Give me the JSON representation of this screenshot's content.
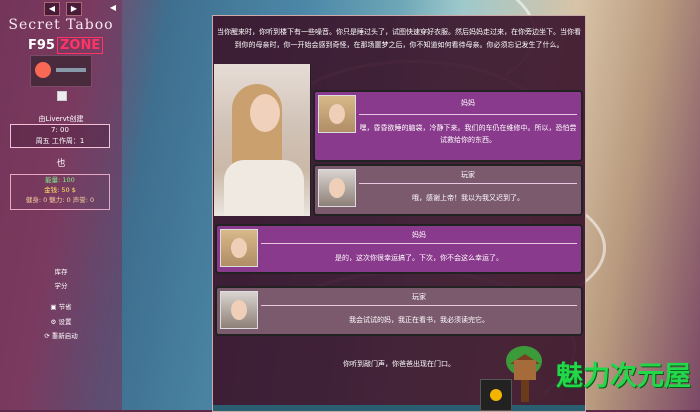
{
  "sidebar": {
    "nav_back": "◀",
    "nav_forward": "▶",
    "collapse": "◀",
    "game_title": "Secret Taboo",
    "f95_prefix": "F95",
    "f95_suffix": "ZONE",
    "creator": "由Livervt创建",
    "time": "7: 00",
    "day": "周五 工作周：1",
    "char_name": "也",
    "energy": "能量: 100",
    "money": "金钱: 50 $",
    "misc": "健身: 0 魅力: 0 声誉: 0",
    "menu": [
      "库存",
      "学分"
    ],
    "options": [
      {
        "icon": "save-icon",
        "label": "节省"
      },
      {
        "icon": "gear-icon",
        "label": "设置"
      },
      {
        "icon": "restart-icon",
        "label": "重新启动"
      }
    ]
  },
  "main": {
    "intro": "当你醒来时，你听到楼下有一些噪音。你只是睡过头了，试图快速穿好衣服。然后妈妈走过来，在你旁边坐下。当你看到你的母亲时，你一开始会感到奇怪，在那场噩梦之后，你不知道如何看待母亲。你必须忘记发生了什么。",
    "dialogue": [
      {
        "speaker": "妈妈",
        "text": "嘿，昏昏欲睡的脑袋，冷静下来。我们的车仍在维修中。所以，恐怕尝试救给你的东西。"
      },
      {
        "speaker": "玩家",
        "text": "哦，感谢上帝！我以为我又迟到了。"
      },
      {
        "speaker": "妈妈",
        "text": "是的，这次你很幸运搞了。下次，你不会这么幸运了。"
      },
      {
        "speaker": "玩家",
        "text": "我会试试的妈，我正在看书，我必须读完它。"
      }
    ],
    "door_text": "你听到敲门声，你爸爸出现在门口。"
  },
  "watermark": {
    "brand": "魅力次元屋"
  },
  "colors": {
    "mom_bubble": "#8a3a8c",
    "player_bubble": "#7b5a6e",
    "panel": "#3c162d",
    "brand_green": "#22d84a"
  }
}
